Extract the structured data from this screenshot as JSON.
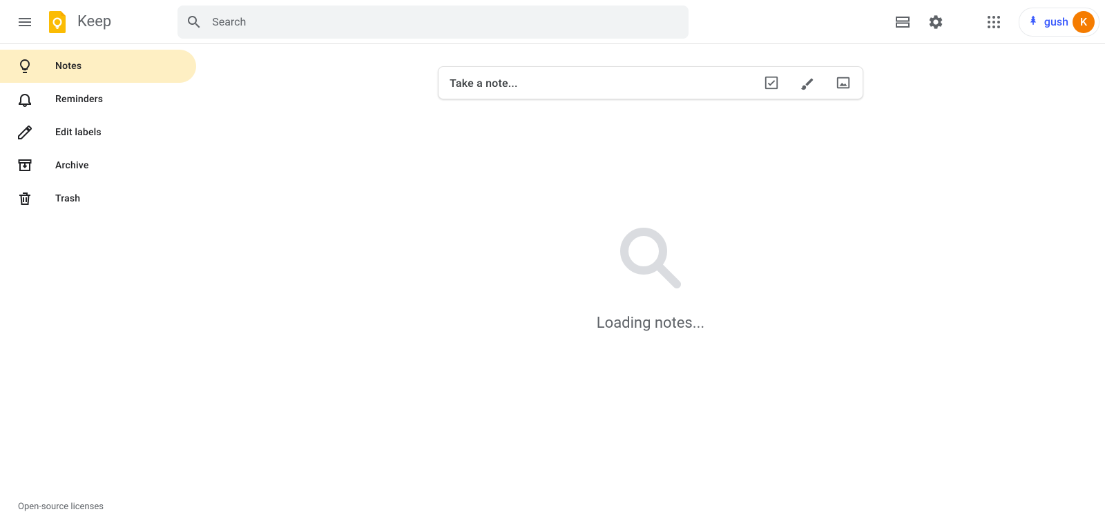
{
  "header": {
    "brand": "Keep",
    "search_placeholder": "Search",
    "gush_label": "gush",
    "avatar_initial": "K"
  },
  "sidebar": {
    "items": [
      {
        "label": "Notes"
      },
      {
        "label": "Reminders"
      },
      {
        "label": "Edit labels"
      },
      {
        "label": "Archive"
      },
      {
        "label": "Trash"
      }
    ]
  },
  "main": {
    "note_placeholder": "Take a note...",
    "loading_text": "Loading notes..."
  },
  "footer": {
    "licenses": "Open-source licenses"
  }
}
